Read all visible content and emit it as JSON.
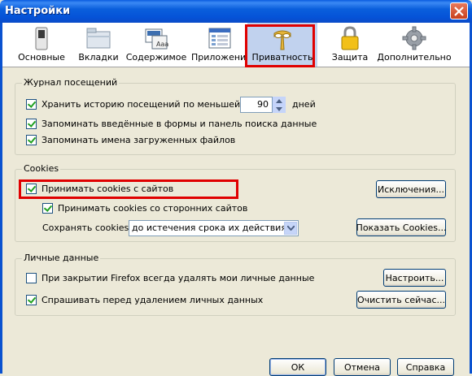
{
  "window": {
    "title": "Настройки"
  },
  "tabs": [
    {
      "label": "Основные",
      "icon": "switch-icon"
    },
    {
      "label": "Вкладки",
      "icon": "folder-tabs-icon"
    },
    {
      "label": "Содержимое",
      "icon": "content-icon"
    },
    {
      "label": "Приложения",
      "icon": "applications-icon"
    },
    {
      "label": "Приватность",
      "icon": "privacy-mask-icon",
      "selected": true
    },
    {
      "label": "Защита",
      "icon": "lock-icon"
    },
    {
      "label": "Дополнительно",
      "icon": "gear-icon"
    }
  ],
  "history": {
    "title": "Журнал посещений",
    "remember_history_label": "Хранить историю посещений по меньшей мере",
    "remember_history_checked": true,
    "days_value": "90",
    "days_unit": "дней",
    "remember_forms_label": "Запоминать введённые в формы и панель поиска данные",
    "remember_forms_checked": true,
    "remember_downloads_label": "Запоминать имена загруженных файлов",
    "remember_downloads_checked": true
  },
  "cookies": {
    "title": "Cookies",
    "accept_label": "Принимать cookies с сайтов",
    "accept_checked": true,
    "third_party_label": "Принимать cookies со сторонних сайтов",
    "third_party_checked": true,
    "keep_label": "Сохранять cookies:",
    "keep_value": "до истечения срока их действия",
    "exceptions_button": "Исключения...",
    "show_cookies_button": "Показать Cookies..."
  },
  "private_data": {
    "title": "Личные данные",
    "clear_on_close_label": "При закрытии Firefox всегда удалять мои личные данные",
    "clear_on_close_checked": false,
    "ask_before_label": "Спрашивать перед удалением личных данных",
    "ask_before_checked": true,
    "settings_button": "Настроить...",
    "clear_now_button": "Очистить сейчас..."
  },
  "footer": {
    "ok": "ОК",
    "cancel": "Отмена",
    "help": "Справка"
  },
  "colors": {
    "highlight": "#e00000",
    "title_bar": "#0a5ce0",
    "selected_tab": "#c1d2ee"
  }
}
